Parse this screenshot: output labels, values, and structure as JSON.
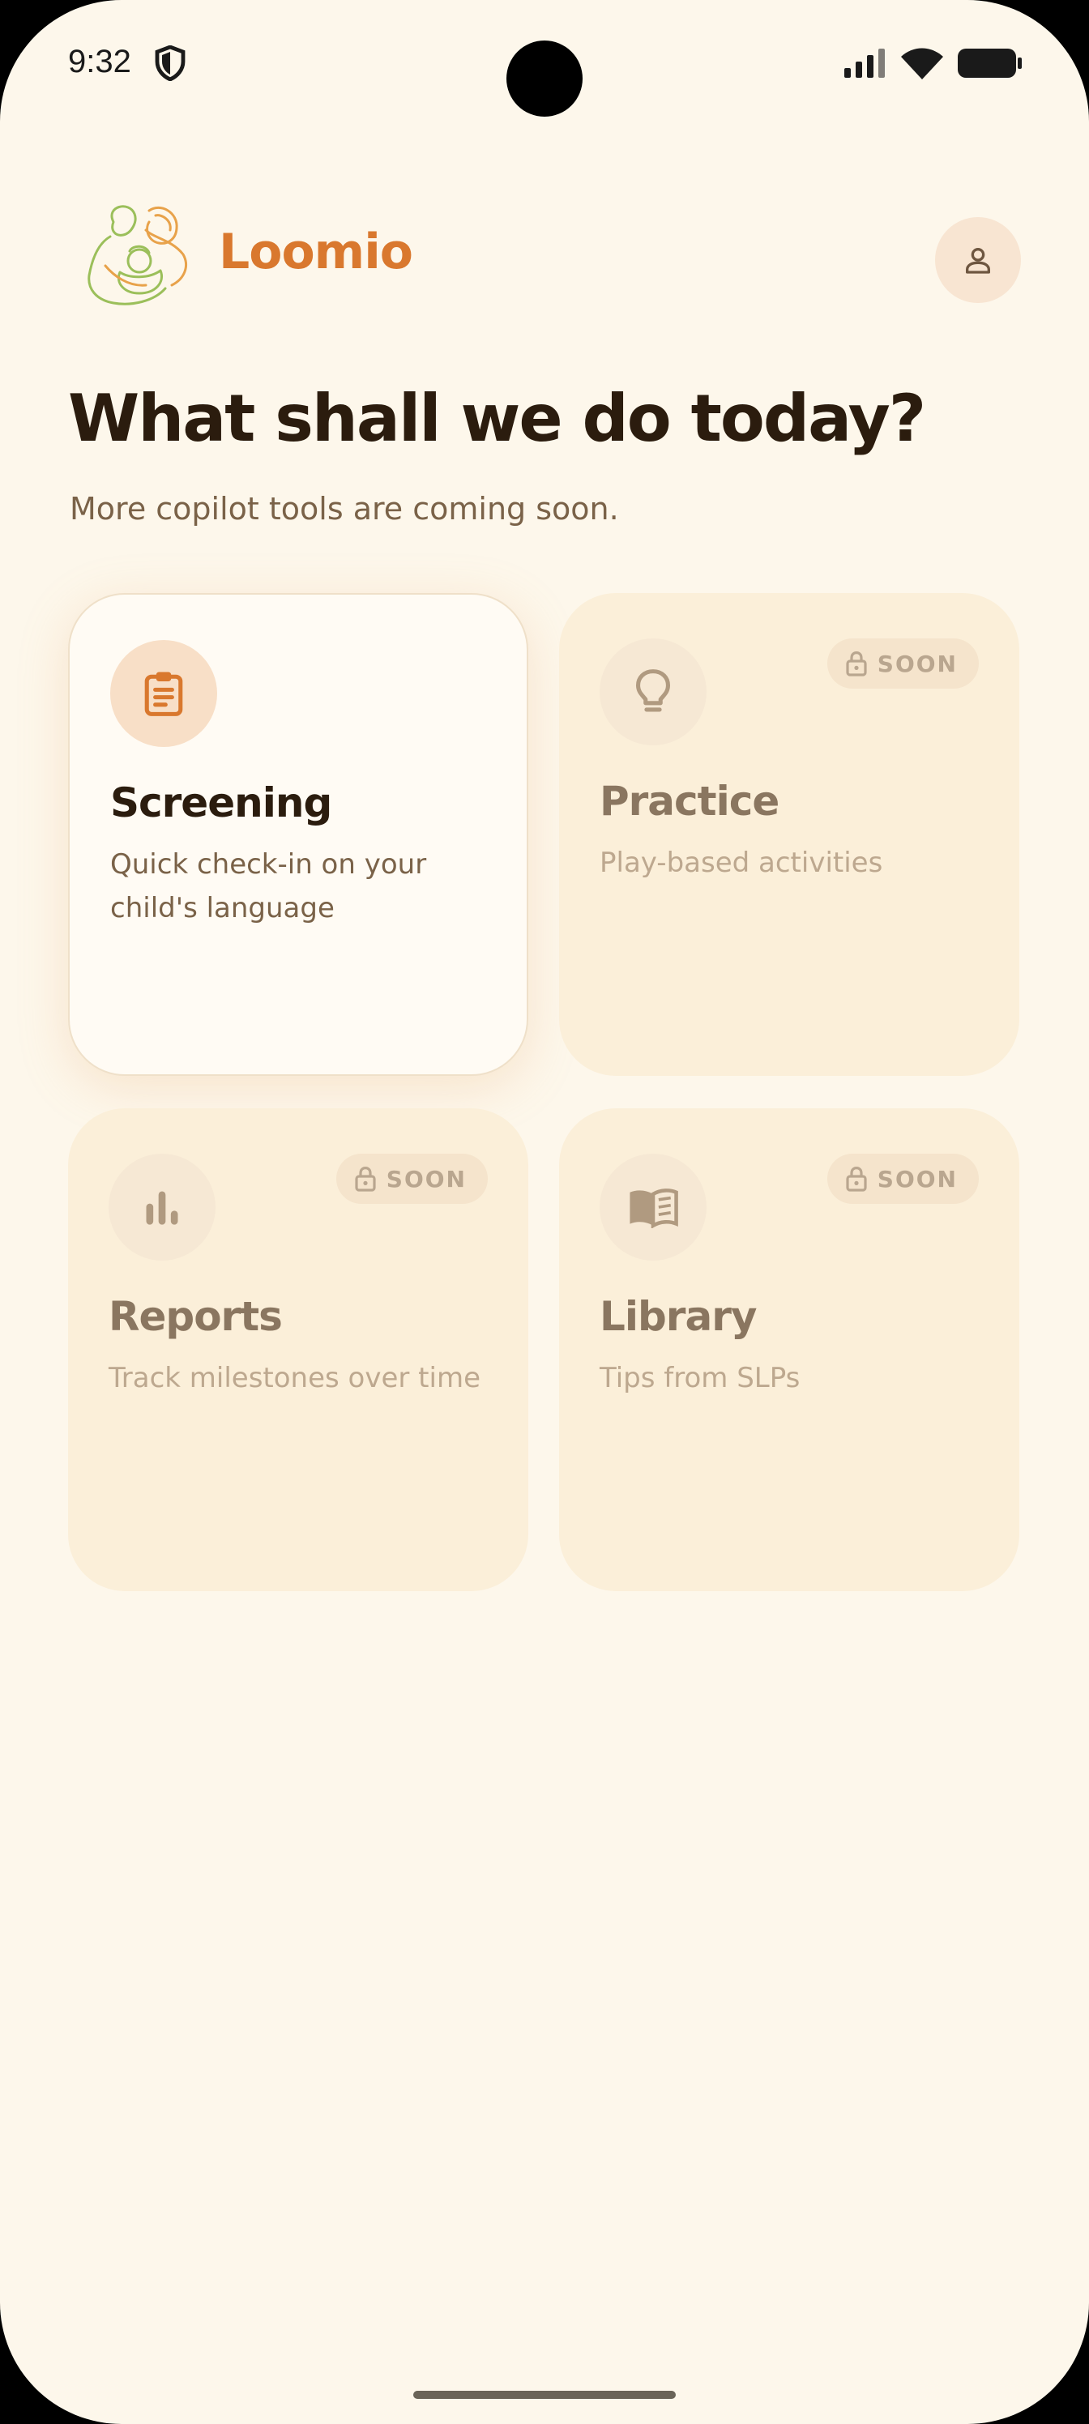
{
  "status_bar": {
    "time": "9:32"
  },
  "header": {
    "brand": "Loomio"
  },
  "main": {
    "title": "What shall we do today?",
    "subtitle": "More copilot tools are coming soon."
  },
  "cards": [
    {
      "title": "Screening",
      "description": "Quick check-in on your child's language",
      "icon": "clipboard-icon",
      "enabled": true
    },
    {
      "title": "Practice",
      "description": "Play-based activities",
      "icon": "lightbulb-icon",
      "badge": "SOON",
      "enabled": false
    },
    {
      "title": "Reports",
      "description": "Track milestones over time",
      "icon": "bar-chart-icon",
      "badge": "SOON",
      "enabled": false
    },
    {
      "title": "Library",
      "description": "Tips from SLPs",
      "icon": "book-icon",
      "badge": "SOON",
      "enabled": false
    }
  ],
  "colors": {
    "background": "#fdf7eb",
    "accent": "#d9782e",
    "heading": "#2b1c0e",
    "card_disabled": "#fbefd9"
  }
}
